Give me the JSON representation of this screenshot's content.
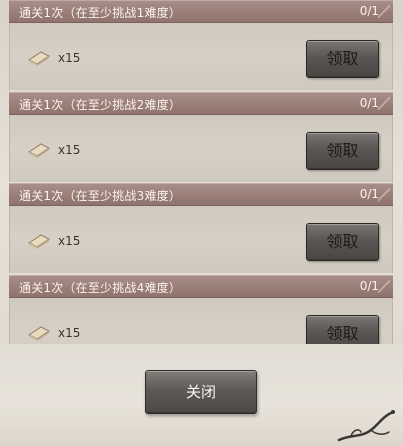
{
  "tasks": [
    {
      "title": "通关1次（在至少挑战1难度）",
      "progress": "0/1",
      "reward_icon": "scroll-icon",
      "reward_count": "x15",
      "claim_label": "领取"
    },
    {
      "title": "通关1次（在至少挑战2难度）",
      "progress": "0/1",
      "reward_icon": "scroll-icon",
      "reward_count": "x15",
      "claim_label": "领取"
    },
    {
      "title": "通关1次（在至少挑战3难度）",
      "progress": "0/1",
      "reward_icon": "scroll-icon",
      "reward_count": "x15",
      "claim_label": "领取"
    },
    {
      "title": "通关1次（在至少挑战4难度）",
      "progress": "0/1",
      "reward_icon": "scroll-icon",
      "reward_count": "x15",
      "claim_label": "领取"
    }
  ],
  "close_label": "关闭",
  "colors": {
    "header_bar": "#9a7f79",
    "panel_bg": "#d6d0c7",
    "button_dark": "#5a5653"
  }
}
